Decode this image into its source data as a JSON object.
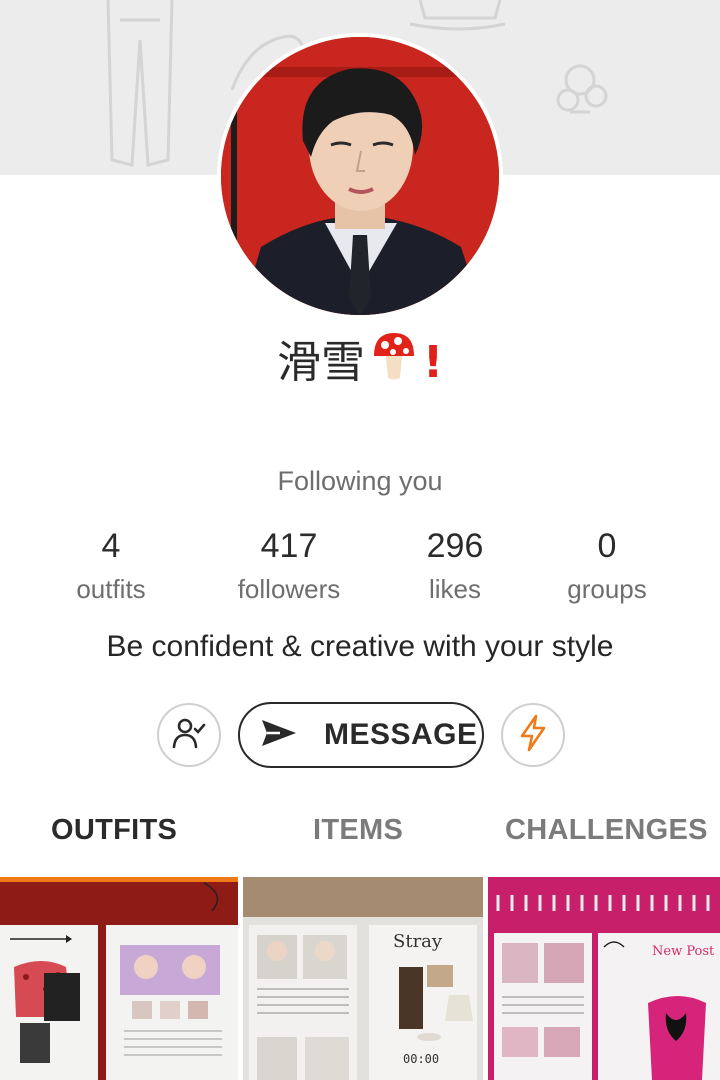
{
  "profile": {
    "name": "滑雪",
    "following_status": "Following you",
    "bio": "Be confident & creative with your style"
  },
  "stats": [
    {
      "value": "4",
      "label": "outfits"
    },
    {
      "value": "417",
      "label": "followers"
    },
    {
      "value": "296",
      "label": "likes"
    },
    {
      "value": "0",
      "label": "groups"
    }
  ],
  "actions": {
    "follow_icon": "user-check-icon",
    "message_label": "MESSAGE",
    "boost_icon": "lightning-icon"
  },
  "tabs": [
    {
      "label": "OUTFITS",
      "active": true
    },
    {
      "label": "ITEMS",
      "active": false
    },
    {
      "label": "CHALLENGES",
      "active": false
    }
  ],
  "grid": {
    "post3_header_text": "New Post",
    "post2_time": "00:00"
  },
  "colors": {
    "accent": "#f07a1a",
    "avatar_bg": "#c8261f",
    "excl": "#e1201b"
  }
}
